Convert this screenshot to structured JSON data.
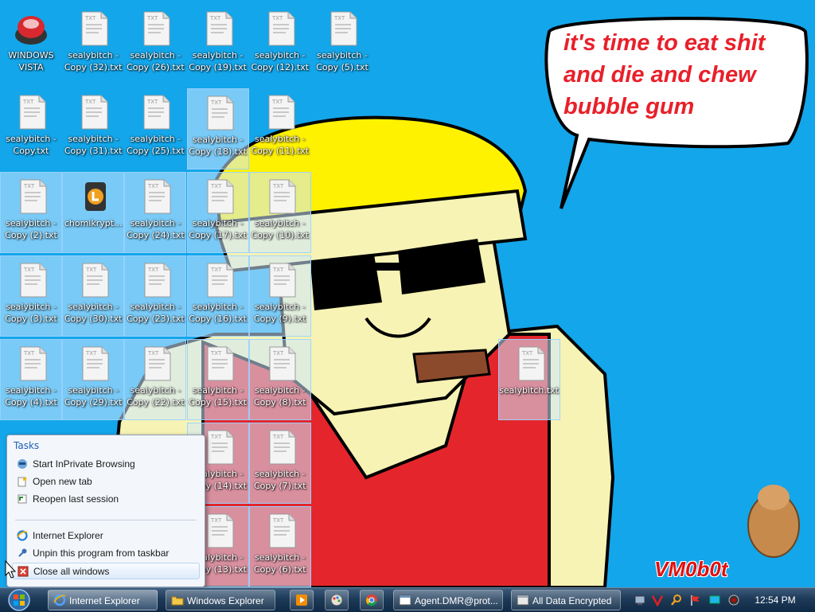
{
  "desktop": {
    "speech_bubble": "it's time to eat shit\nand die and chew\nbubble gum",
    "signature": "VM0b0t",
    "icons": [
      {
        "label": "WINDOWS\nVISTA",
        "kind": "app-vista",
        "selected": false
      },
      {
        "label": "sealybitch -\nCopy (32).txt",
        "kind": "txt",
        "selected": false
      },
      {
        "label": "sealybitch -\nCopy (26).txt",
        "kind": "txt",
        "selected": false
      },
      {
        "label": "sealybitch -\nCopy (19).txt",
        "kind": "txt",
        "selected": false
      },
      {
        "label": "sealybitch -\nCopy (12).txt",
        "kind": "txt",
        "selected": false
      },
      {
        "label": "sealybitch -\nCopy (5).txt",
        "kind": "txt",
        "selected": false
      },
      {
        "label": "sealybitch -\nCopy.txt",
        "kind": "txt",
        "selected": false
      },
      {
        "label": "sealybitch -\nCopy (31).txt",
        "kind": "txt",
        "selected": false
      },
      {
        "label": "sealybitch -\nCopy (25).txt",
        "kind": "txt",
        "selected": false
      },
      {
        "label": "sealybitch -\nCopy (18).txt",
        "kind": "txt",
        "selected": true
      },
      {
        "label": "sealybitch -\nCopy (11).txt",
        "kind": "txt",
        "selected": false
      },
      {
        "label": "sealybitch -\nCopy (2).txt",
        "kind": "txt",
        "selected": true
      },
      {
        "label": "chomikrypt...",
        "kind": "app-chomik",
        "selected": true
      },
      {
        "label": "sealybitch -\nCopy (24).txt",
        "kind": "txt",
        "selected": true
      },
      {
        "label": "sealybitch -\nCopy (17).txt",
        "kind": "txt",
        "selected": true
      },
      {
        "label": "sealybitch -\nCopy (10).txt",
        "kind": "txt",
        "selected": true
      },
      {
        "label": "sealybitch -\nCopy (3).txt",
        "kind": "txt",
        "selected": true
      },
      {
        "label": "sealybitch -\nCopy (30).txt",
        "kind": "txt",
        "selected": true
      },
      {
        "label": "sealybitch -\nCopy (23).txt",
        "kind": "txt",
        "selected": true
      },
      {
        "label": "sealybitch -\nCopy (16).txt",
        "kind": "txt",
        "selected": true
      },
      {
        "label": "sealybitch -\nCopy (9).txt",
        "kind": "txt",
        "selected": true
      },
      {
        "label": "sealybitch -\nCopy (4).txt",
        "kind": "txt",
        "selected": true
      },
      {
        "label": "sealybitch -\nCopy (29).txt",
        "kind": "txt",
        "selected": true
      },
      {
        "label": "sealybitch -\nCopy (22).txt",
        "kind": "txt",
        "selected": true
      },
      {
        "label": "sealybitch -\nCopy (15).txt",
        "kind": "txt",
        "selected": true
      },
      {
        "label": "sealybitch -\nCopy (8).txt",
        "kind": "txt",
        "selected": true
      },
      {
        "label": "sealybitch.txt",
        "kind": "txt",
        "selected": true
      },
      {
        "label": "sealybitch -\nCopy (14).txt",
        "kind": "txt",
        "selected": true
      },
      {
        "label": "sealybitch -\nCopy (7).txt",
        "kind": "txt",
        "selected": true
      },
      {
        "label": "sealybitch -\nCopy (13).txt",
        "kind": "txt",
        "selected": true
      },
      {
        "label": "sealybitch -\nCopy (6).txt",
        "kind": "txt",
        "selected": true
      }
    ]
  },
  "jump_list": {
    "header": "Tasks",
    "tasks": [
      {
        "label": "Start InPrivate Browsing",
        "icon": "inprivate-icon"
      },
      {
        "label": "Open new tab",
        "icon": "new-tab-icon"
      },
      {
        "label": "Reopen last session",
        "icon": "reopen-session-icon"
      }
    ],
    "pinned": [
      {
        "label": "Internet Explorer",
        "icon": "internet-explorer-icon"
      },
      {
        "label": "Unpin this program from taskbar",
        "icon": "unpin-icon"
      },
      {
        "label": "Close all windows",
        "icon": "close-windows-icon",
        "highlighted": true
      }
    ]
  },
  "taskbar": {
    "buttons": [
      {
        "label": "Internet Explorer",
        "icon": "internet-explorer-icon",
        "active": true
      },
      {
        "label": "Windows Explorer",
        "icon": "folder-icon",
        "active": false
      },
      {
        "label": "",
        "icon": "media-player-icon",
        "active": false
      },
      {
        "label": "",
        "icon": "paint-icon",
        "active": false
      },
      {
        "label": "",
        "icon": "chrome-icon",
        "active": false
      },
      {
        "label": "Agent.DMR@prot...",
        "icon": "window-icon",
        "active": false
      },
      {
        "label": "All Data Encrypted",
        "icon": "window-icon",
        "active": false
      }
    ],
    "clock": "12:54 PM",
    "tray_icons": [
      "network-icon",
      "antivirus-icon",
      "search-tray-icon",
      "flag-icon",
      "display-icon",
      "speaker-icon"
    ]
  },
  "colors": {
    "desktop": "#13a6ea",
    "speech_text": "#e8202a",
    "jumplist_header": "#1e5fb4"
  }
}
